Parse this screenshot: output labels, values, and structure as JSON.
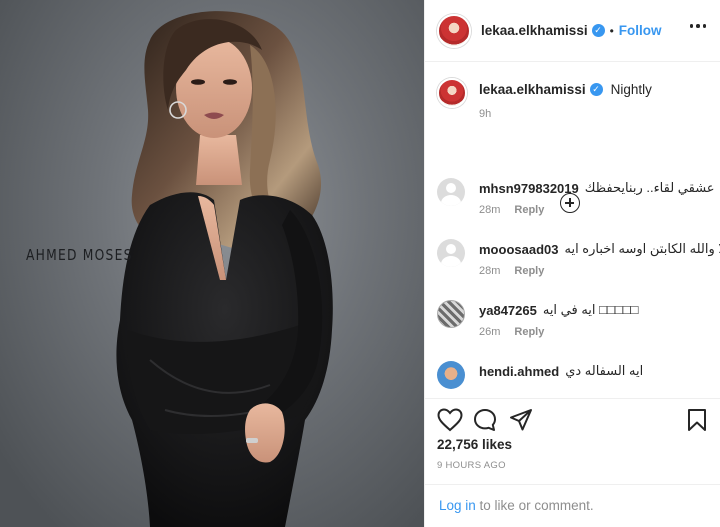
{
  "photo": {
    "watermark": "AHMED MOSES"
  },
  "header": {
    "username": "lekaa.elkhamissi",
    "separator": "•",
    "follow_label": "Follow"
  },
  "caption": {
    "username": "lekaa.elkhamissi",
    "text": "Nightly",
    "time": "9h"
  },
  "comments": [
    {
      "user": "mhsn979832019",
      "text": "عشقي لقاء.. ربنايحفظك",
      "time": "28m",
      "reply": "Reply"
    },
    {
      "user": "mooosaad03",
      "text": "هلا والله الكابتن اوسه اخباره ايه",
      "time": "28m",
      "reply": "Reply"
    },
    {
      "user": "ya847265",
      "text": "ايه في ايه □□□□□",
      "time": "26m",
      "reply": "Reply"
    },
    {
      "user": "hendi.ahmed",
      "text": "ايه السفاله دي",
      "time": "",
      "reply": ""
    }
  ],
  "stats": {
    "likes": "22,756 likes",
    "posted": "9 HOURS AGO"
  },
  "footer": {
    "login_label": "Log in",
    "rest": " to like or comment."
  },
  "icons": {
    "more": "more-icon",
    "add_comments": "plus-circle-icon",
    "like": "heart-icon",
    "comment": "comment-icon",
    "share": "share-icon",
    "save": "bookmark-icon",
    "verified": "verified-badge-icon"
  },
  "colors": {
    "link": "#3897f0",
    "secondary_text": "#8e8e8e",
    "primary_text": "#262626"
  }
}
